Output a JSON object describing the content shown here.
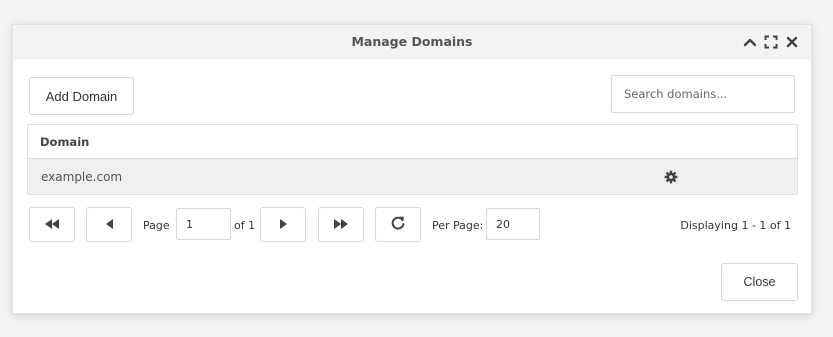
{
  "dialog": {
    "title": "Manage Domains",
    "controls": {
      "collapse_icon": "chevron-up-icon",
      "maximize_icon": "maximize-icon",
      "close_icon": "close-icon"
    }
  },
  "toolbar": {
    "add_label": "Add Domain",
    "search_placeholder": "Search domains...",
    "search_value": ""
  },
  "grid": {
    "columns": [
      "Domain"
    ],
    "rows": [
      {
        "domain": "example.com",
        "action_icon": "gear-icon"
      }
    ]
  },
  "pagination": {
    "first_icon": "first-page-icon",
    "prev_icon": "prev-page-icon",
    "next_icon": "next-page-icon",
    "last_icon": "last-page-icon",
    "refresh_icon": "refresh-icon",
    "page_label": "Page",
    "page_value": "1",
    "of_label": "of 1",
    "per_page_label": "Per Page:",
    "per_page_value": "20",
    "displaying": "Displaying 1 - 1 of 1"
  },
  "footer": {
    "close_label": "Close"
  },
  "colors": {
    "titlebar_bg": "#f3f3f3",
    "row_bg": "#efefef",
    "icon": "#444444"
  }
}
